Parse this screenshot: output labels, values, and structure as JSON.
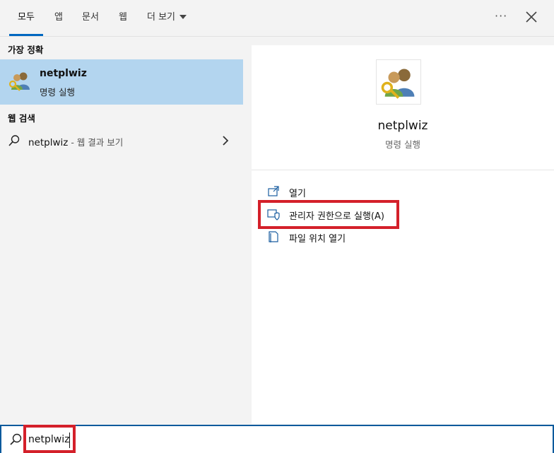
{
  "tabs": [
    {
      "label": "모두",
      "active": true
    },
    {
      "label": "앱"
    },
    {
      "label": "문서"
    },
    {
      "label": "웹"
    },
    {
      "label": "더 보기"
    }
  ],
  "header": {
    "more_options_icon": "ellipsis-icon",
    "close_icon": "close-icon"
  },
  "left": {
    "best_match_title": "가장 정확",
    "best_match": {
      "name": "netplwiz",
      "subtitle": "명령 실행",
      "icon": "users-key-icon"
    },
    "web_title": "웹 검색",
    "web_result": {
      "query": "netplwiz",
      "hint": " - 웹 결과 보기"
    }
  },
  "detail": {
    "title": "netplwiz",
    "subtitle": "명령 실행",
    "actions": [
      {
        "label": "열기",
        "icon": "open-icon"
      },
      {
        "label": "관리자 권한으로 실행(A)",
        "icon": "shield-icon"
      },
      {
        "label": "파일 위치 열기",
        "icon": "file-location-icon"
      }
    ]
  },
  "search": {
    "value": "netplwiz",
    "icon": "search-icon"
  },
  "colors": {
    "accent": "#0067c0",
    "selection": "#b3d5ef",
    "highlight": "#d4202a",
    "search_border": "#0a5a9c"
  }
}
